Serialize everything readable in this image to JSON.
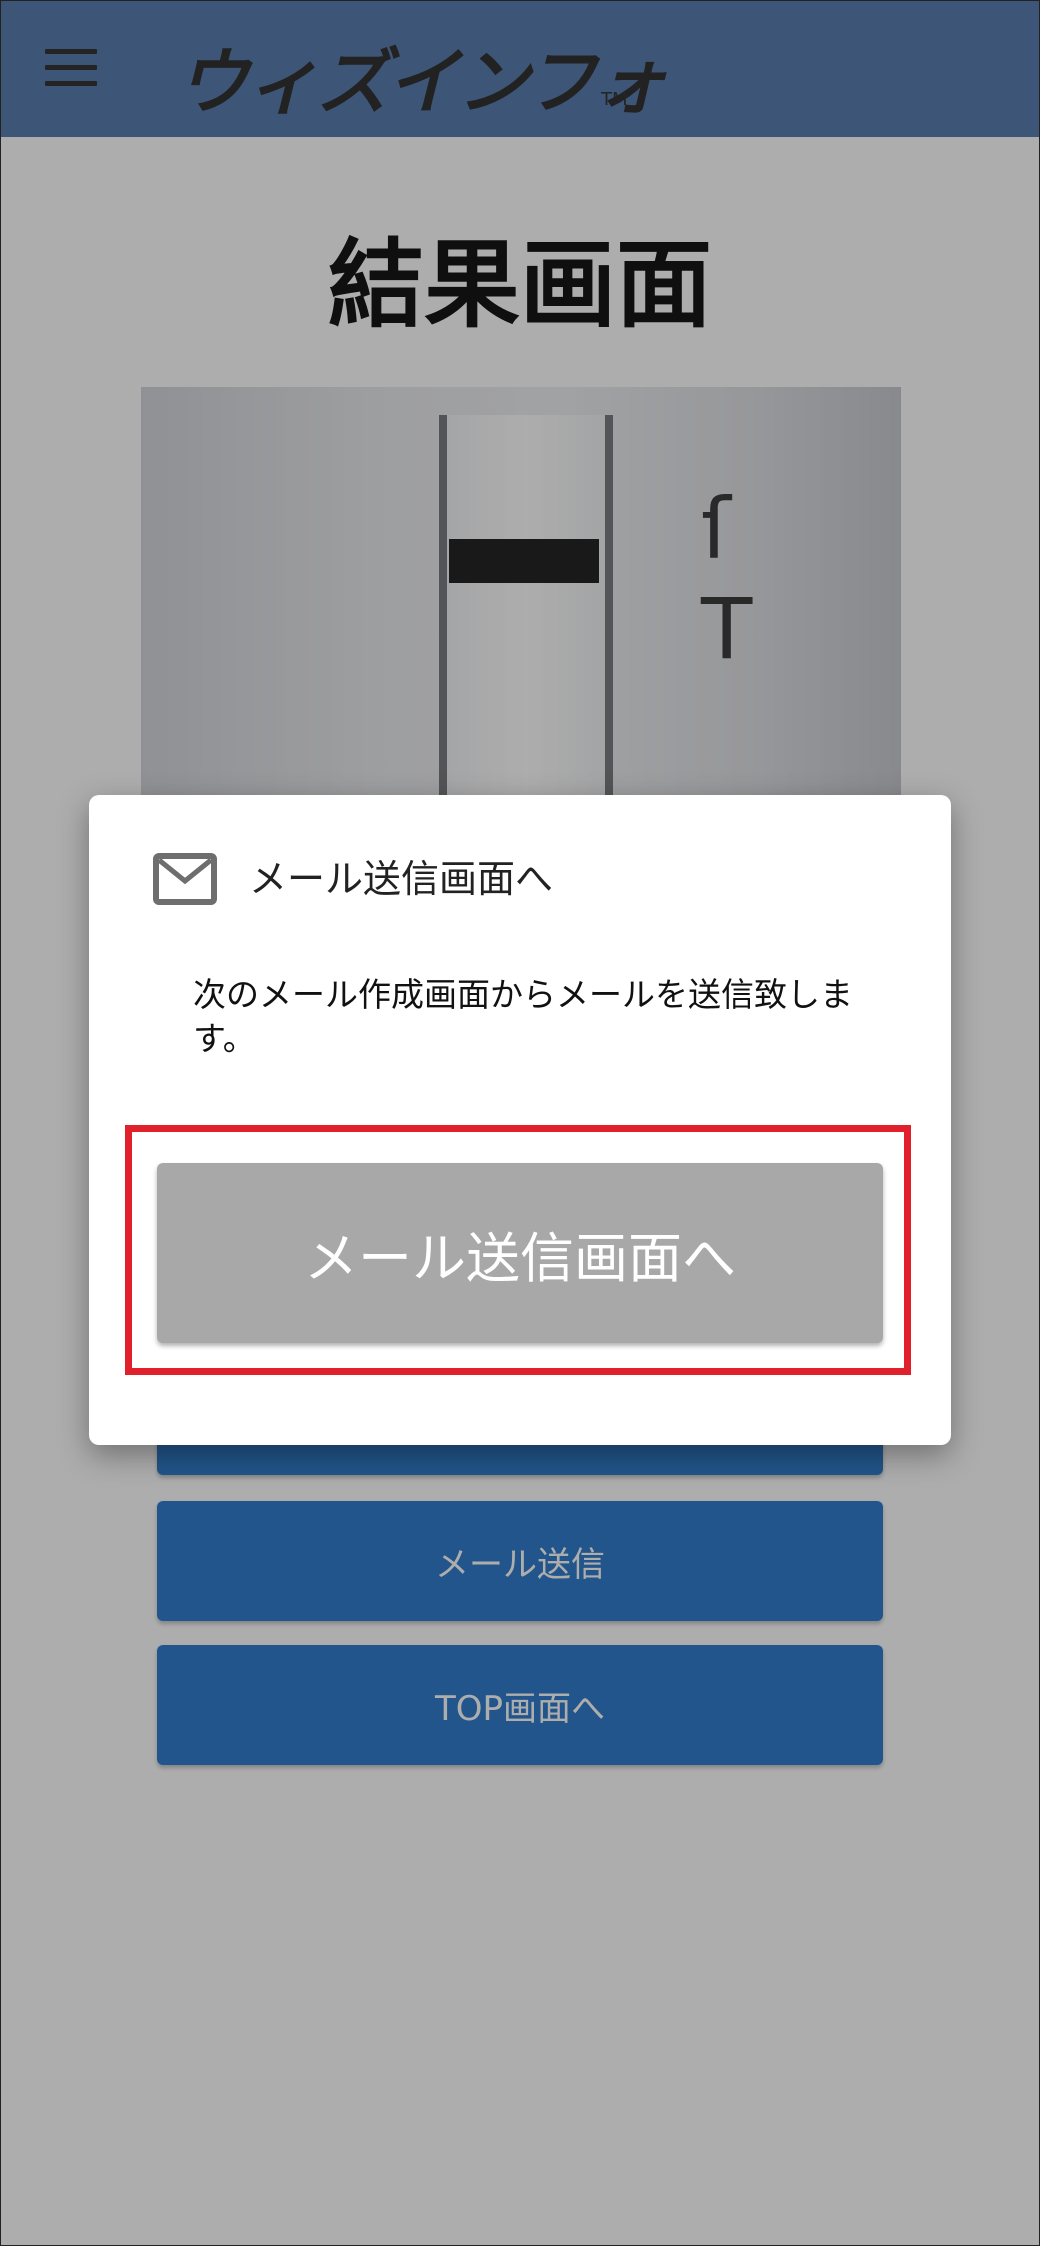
{
  "header": {
    "menu_icon": "hamburger-menu-icon",
    "logo_text": "ウィズインフォ",
    "logo_tm": "TM",
    "background_color": "#4b72a6"
  },
  "page": {
    "title": "結果画面"
  },
  "buttons": {
    "mail_send": "メール送信",
    "top": "TOP画面へ",
    "color": "#1d72c9"
  },
  "dialog": {
    "icon": "mail-icon",
    "title": "メール送信画面へ",
    "message": "次のメール作成画面からメールを送信致します。",
    "action_label": "メール送信画面へ",
    "highlight_color": "#e0202b"
  }
}
